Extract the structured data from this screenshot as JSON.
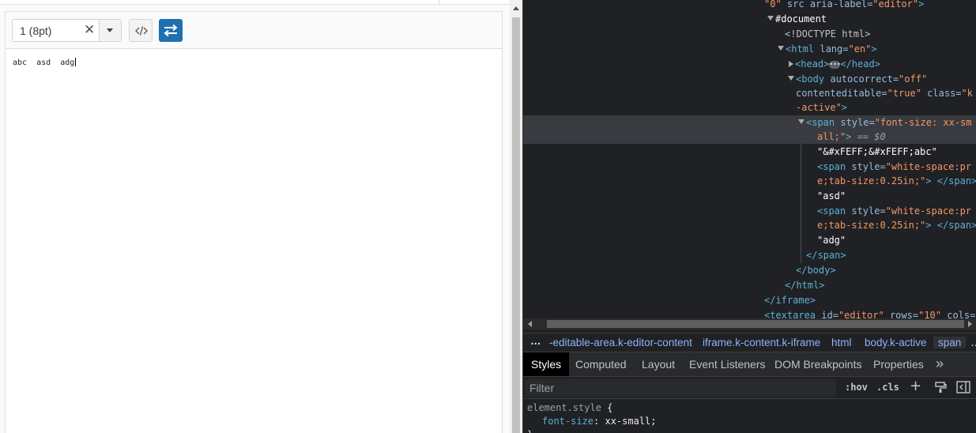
{
  "editor": {
    "font_size_value": "1 (8pt)",
    "clear_glyph": "✕",
    "content_parts": [
      "abc",
      "asd",
      "adg"
    ]
  },
  "devtools": {
    "dom_lines": {
      "iframe_tail_a": "\"0\"",
      "iframe_tail_b": " src",
      "iframe_tail_c": " aria-label=",
      "iframe_tail_d": "\"editor\"",
      "iframe_tail_e": ">",
      "document": "#document",
      "doctype": "<!DOCTYPE html>",
      "html_open_a": "<html",
      "html_open_b": " lang=",
      "html_open_c": "\"en\"",
      "html_open_d": ">",
      "head_open": "<head>",
      "head_close": "</head>",
      "body_open_a": "<body",
      "body_open_b": " autocorrect=",
      "body_open_c": "\"off\"",
      "body_line2_a": "contenteditable=",
      "body_line2_b": "\"true\"",
      "body_line2_c": " class=",
      "body_line2_d": "\"k",
      "body_line3_a": "-active\"",
      "body_line3_b": ">",
      "span_open_a": "<span",
      "span_open_b": " style=",
      "span_open_c": "\"font-size: xx-sm",
      "span_line2_a": "all;\"",
      "span_line2_b": ">",
      "span_line2_c": " == ",
      "span_line2_d": "$0",
      "text_abc": "\"&#xFEFF;&#xFEFF;abc\"",
      "tab_span_a": "<span",
      "tab_span_b": " style=",
      "tab_span_c": "\"white-space:pr",
      "tab_span_line2_a": "e;tab-size:0.25in;\"",
      "tab_span_line2_b": "> </span>",
      "text_asd": "\"asd\"",
      "text_adg": "\"adg\"",
      "span_close": "</span>",
      "body_close": "</body>",
      "html_close": "</html>",
      "iframe_close": "</iframe>",
      "textarea_a": "<textarea",
      "textarea_b": " id=",
      "textarea_c": "\"editor\"",
      "textarea_d": " rows=",
      "textarea_e": "\"10\"",
      "textarea_f": " cols="
    },
    "breadcrumbs": {
      "more": "…",
      "items": [
        "-editable-area.k-editor-content",
        "iframe.k-content.k-iframe",
        "html",
        "body.k-active",
        "span"
      ],
      "overflow": "…"
    },
    "tabs": [
      "Styles",
      "Computed",
      "Layout",
      "Event Listeners",
      "DOM Breakpoints",
      "Properties"
    ],
    "tabs_more": "»",
    "filter_placeholder": "Filter",
    "hov": ":hov",
    "cls": ".cls",
    "plus": "+",
    "styles": {
      "selector": "element.style",
      "open_brace": " {",
      "property": "font-size",
      "colon": ": ",
      "value": "xx-small;",
      "close_brace": "}"
    }
  },
  "colors": {
    "accent_button": "#1f70b0",
    "devtools_bg": "#202124",
    "tag": "#5db0d7",
    "attr_value": "#f29766",
    "link": "#8ab4f8"
  }
}
